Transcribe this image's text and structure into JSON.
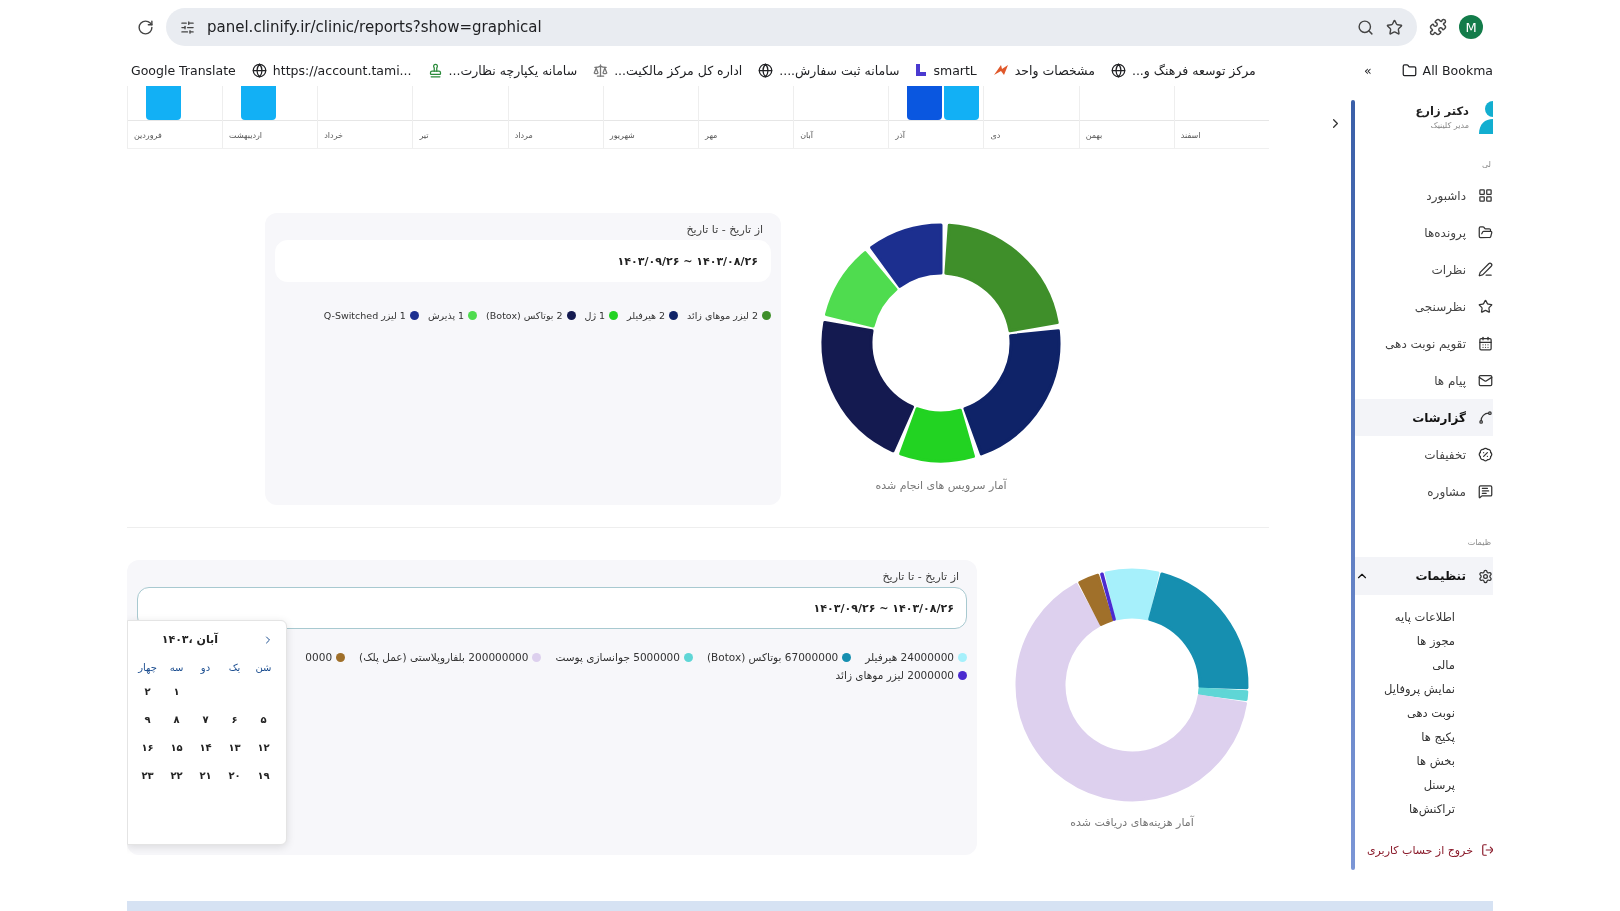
{
  "browser": {
    "url": "panel.clinify.ir/clinic/reports?show=graphical",
    "profile_initial": "M",
    "all_bookmarks": "All Bookma",
    "more": "»",
    "bookmarks": [
      {
        "label": "مرکز توسعه فرهنگ و...",
        "kind": "globe"
      },
      {
        "label": "مشخصات واحد",
        "kind": "brand"
      },
      {
        "label": "smartL",
        "kind": "letter"
      },
      {
        "label": "سامانه ثبت سفارش....",
        "kind": "globe"
      },
      {
        "label": "اداره کل مرکز مالکیت...",
        "kind": "scale"
      },
      {
        "label": "سامانه یکپارچه نظارت...",
        "kind": "stamp"
      },
      {
        "label": "https://account.tami...",
        "kind": "globe"
      },
      {
        "label": "Google Translate",
        "kind": "plain"
      }
    ]
  },
  "monthly_chart": {
    "months": [
      {
        "label": "اسفند"
      },
      {
        "label": "بهمن"
      },
      {
        "label": "دی"
      },
      {
        "label": "آذر",
        "bars": [
          {
            "kind": "dark"
          },
          {
            "kind": "light"
          }
        ]
      },
      {
        "label": "آبان"
      },
      {
        "label": "مهر"
      },
      {
        "label": "شهریور"
      },
      {
        "label": "مرداد"
      },
      {
        "label": "تیر"
      },
      {
        "label": "خرداد"
      },
      {
        "label": "اردیبهشت",
        "bars": [
          {
            "kind": "light"
          }
        ]
      },
      {
        "label": "فروردین",
        "bars": [
          {
            "kind": "light"
          }
        ]
      }
    ]
  },
  "services_report": {
    "date_label": "از تاریخ - تا تاریخ",
    "date_range": "۱۴۰۳/۰۸/۲۶ ~ ۱۴۰۳/۰۹/۲۶",
    "date_focused": false,
    "chart_data": {
      "type": "donut",
      "title": "آمار سرویس های انجام شده",
      "categories": [
        "2 لیزر موهای زائد",
        "2 هیرفیلر",
        "1 ژل",
        "2 بوتاکس (Botox)",
        "1 پذیرش",
        "1 لیزر Q-Switched"
      ],
      "values": [
        2,
        2,
        1,
        2,
        1,
        1
      ],
      "colors": [
        "#3f8f2a",
        "#0f2368",
        "#22d322",
        "#141a50",
        "#4fdc4f",
        "#1c2f8f"
      ]
    }
  },
  "costs_report": {
    "date_label": "از تاریخ - تا تاریخ",
    "date_range": "۱۴۰۳/۰۸/۲۶ ~ ۱۴۰۳/۰۹/۲۶",
    "date_focused": true,
    "chart_data": {
      "type": "donut",
      "title": "آمار هزینه‌های دریافت شده",
      "categories": [
        "24000000 هیرفیلر",
        "67000000 بوتاکس (Botox)",
        "5000000 جوانسازی پوست",
        "200000000 بلفاروپلاستی (عمل پلک)",
        "0000",
        "2000000 لیزر موهای زائد"
      ],
      "values": [
        24000000,
        67000000,
        5000000,
        200000000,
        10000000,
        2000000
      ],
      "colors": [
        "#a6f0fb",
        "#168fb0",
        "#5fd6d6",
        "#ddd0ee",
        "#a0702a",
        "#4b2bd0"
      ]
    }
  },
  "date_picker": {
    "month": "آبان ،۱۴۰۳",
    "weekdays": [
      "شن",
      "یک",
      "دو",
      "سه",
      "چهار"
    ],
    "weeks": [
      [
        "۱",
        "۲"
      ],
      [
        "۵",
        "۶",
        "۷",
        "۸",
        "۹"
      ],
      [
        "۱۲",
        "۱۳",
        "۱۴",
        "۱۵",
        "۱۶"
      ],
      [
        "۱۹",
        "۲۰",
        "۲۱",
        "۲۲",
        "۲۳"
      ]
    ]
  },
  "sidebar": {
    "user_name": "دکتر زارع",
    "user_role": "مدیر کلینیک",
    "main_label": "لی",
    "items": [
      {
        "label": "داشبورد",
        "kind": "grid",
        "selected": false
      },
      {
        "label": "پرونده‌ها",
        "kind": "folder",
        "selected": false
      },
      {
        "label": "نظرات",
        "kind": "pen",
        "selected": false
      },
      {
        "label": "نظرسنجی",
        "kind": "star",
        "selected": false
      },
      {
        "label": "تقویم نوبت دهی",
        "kind": "calendar",
        "selected": false
      },
      {
        "label": "پیام ها",
        "kind": "mail",
        "selected": false
      },
      {
        "label": "گزارشات",
        "kind": "route",
        "selected": true
      },
      {
        "label": "تخفیفات",
        "kind": "percent",
        "selected": false
      },
      {
        "label": "مشاوره",
        "kind": "chat",
        "selected": false
      }
    ],
    "settings_label": "ظیمات",
    "settings": {
      "label": "تنظیمات",
      "expanded": true,
      "children": [
        "اطلاعات پایه",
        "مجوز ها",
        "مالی",
        "نمایش پروفایل",
        "نوبت دهی",
        "پکیج ها",
        "بخش ها",
        "پرسنل",
        "تراکنش‌ها"
      ]
    },
    "logout": "خروج از حساب کاربری"
  }
}
